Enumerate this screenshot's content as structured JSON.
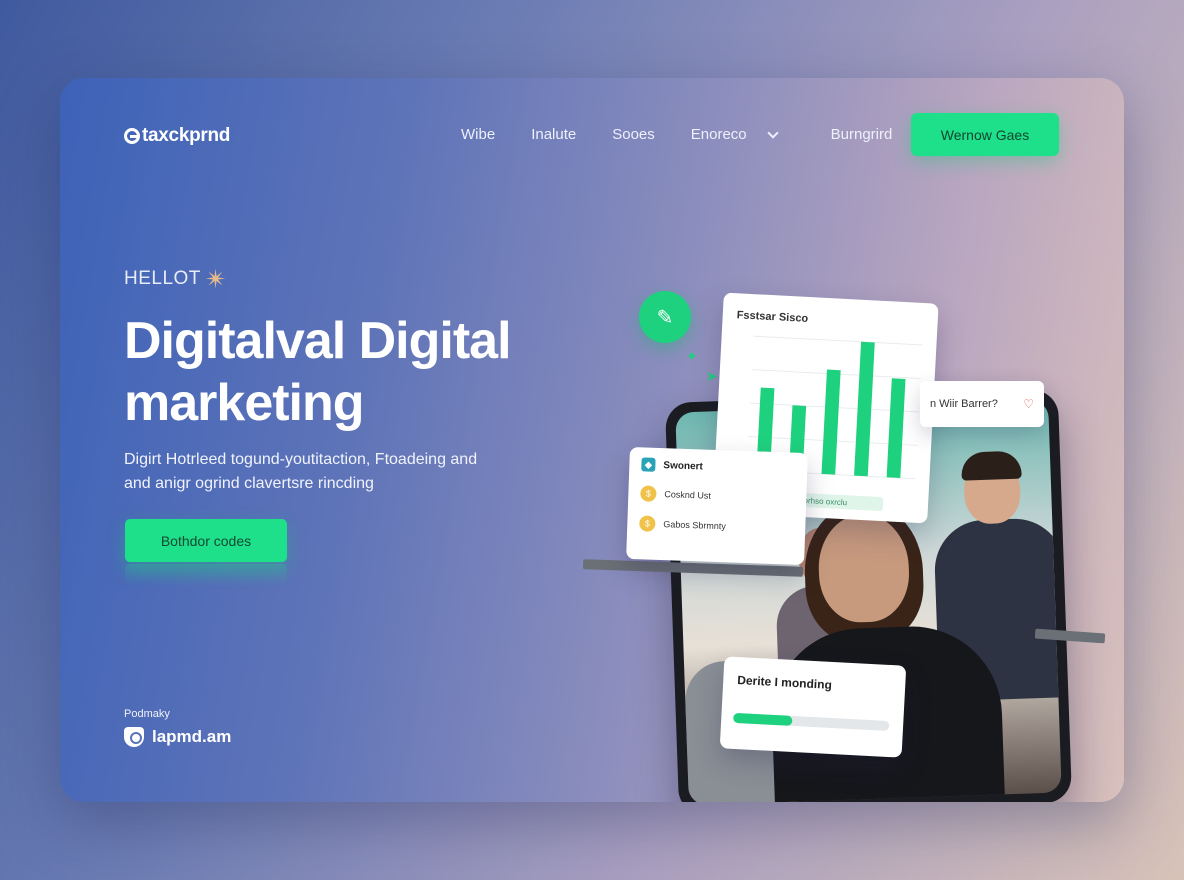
{
  "header": {
    "logo_text": "taxckprnd",
    "nav": [
      {
        "label": "Wibe"
      },
      {
        "label": "Inalute"
      },
      {
        "label": "Sooes"
      },
      {
        "label": "Enoreco",
        "has_dropdown": true
      },
      {
        "label": "Burngrird"
      }
    ],
    "cta_label": "Wernow Gaes"
  },
  "hero": {
    "eyebrow": "HELLOT",
    "headline_line1": "Digitalval Digital",
    "headline_line2": "marketing",
    "subtext_line1": "Digirt Hotrleed togund-youtitaction, Ftoadeing and",
    "subtext_line2": "and anigr ogrind clavertsre rincding",
    "button_label": "Bothdor codes"
  },
  "footer": {
    "label": "Podmaky",
    "brand": "lapmd.am"
  },
  "illustration": {
    "chart_card_title": "Fsstsar Sisco",
    "chart_card_footer": "Lorhso oxrclu",
    "question_card_text": "n Wiir Barrer?",
    "list_card": {
      "title": "Swonert",
      "rows": [
        {
          "text": "Cosknd Ust"
        },
        {
          "text": "Gabos Sbrmnty"
        }
      ]
    },
    "progress_card": {
      "title": "Derite I monding",
      "progress": 0.38
    },
    "bars": [
      0.62,
      0.5,
      0.78,
      1.0,
      0.74
    ]
  },
  "colors": {
    "accent": "#1ee08a",
    "brand_green": "#1ed17e"
  },
  "icons": {
    "logo": "circle-e-logo-icon",
    "star": "sparkle-star-icon",
    "dropdown": "chevron-down-icon",
    "footer": "shield-logo-icon",
    "heart": "heart-icon"
  }
}
